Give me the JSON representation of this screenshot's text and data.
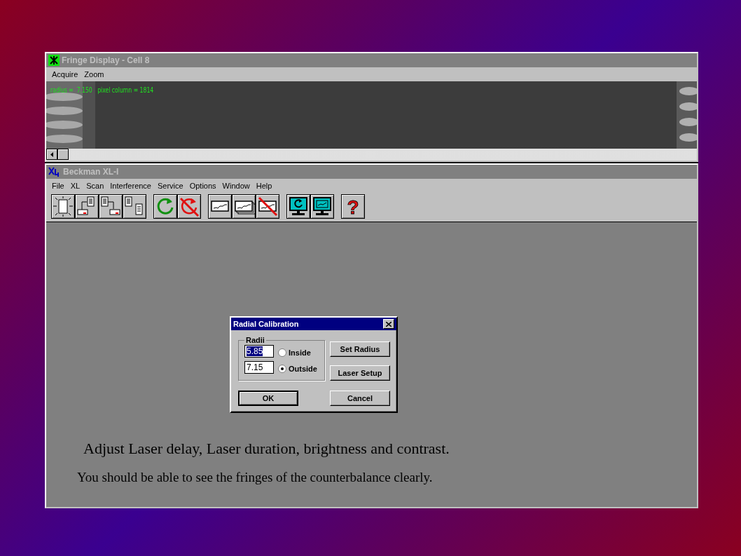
{
  "fringe_window": {
    "title": "Fringe Display - Cell 8",
    "menu": [
      {
        "label": "Acquire"
      },
      {
        "label": "Zoom"
      }
    ],
    "readout": "radius =  7.150   pixel column = 1814"
  },
  "main_window": {
    "title": "Beckman XL-I",
    "menu": [
      {
        "label": "File"
      },
      {
        "label": "XL"
      },
      {
        "label": "Scan"
      },
      {
        "label": "Interference"
      },
      {
        "label": "Service"
      },
      {
        "label": "Options"
      },
      {
        "label": "Window"
      },
      {
        "label": "Help"
      }
    ],
    "toolbar": [
      [
        {
          "kind": "lamp"
        },
        {
          "kind": "export"
        },
        {
          "kind": "import"
        },
        {
          "kind": "print"
        }
      ],
      [
        {
          "kind": "refresh"
        },
        {
          "kind": "no-refresh"
        }
      ],
      [
        {
          "kind": "plot"
        },
        {
          "kind": "plot-stack"
        },
        {
          "kind": "no-plot"
        }
      ],
      [
        {
          "kind": "monitor-refresh"
        },
        {
          "kind": "monitor-plot"
        }
      ],
      [
        {
          "kind": "help",
          "glyph": "?"
        }
      ]
    ]
  },
  "dialog": {
    "title": "Radial Calibration",
    "group": "Radii",
    "fields": [
      {
        "value": "5.85",
        "selected": true
      },
      {
        "value": "7.15",
        "selected": false
      }
    ],
    "radios": [
      {
        "label": "Inside",
        "selected": false
      },
      {
        "label": "Outside",
        "selected": true
      }
    ],
    "side_buttons": [
      "Set Radius",
      "Laser Setup"
    ],
    "ok": "OK",
    "cancel": "Cancel"
  },
  "captions": [
    "Adjust Laser delay, Laser duration, brightness and contrast.",
    "You should be able to see the fringes of the counterbalance clearly."
  ]
}
